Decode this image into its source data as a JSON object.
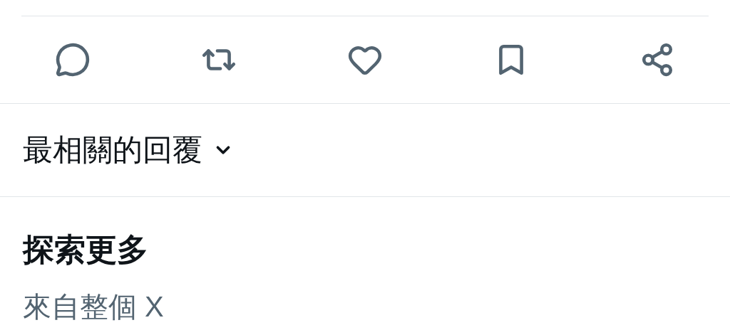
{
  "reply_sort": {
    "label": "最相關的回覆",
    "expanded": false
  },
  "explore": {
    "title": "探索更多",
    "subtitle": "來自整個 X"
  }
}
